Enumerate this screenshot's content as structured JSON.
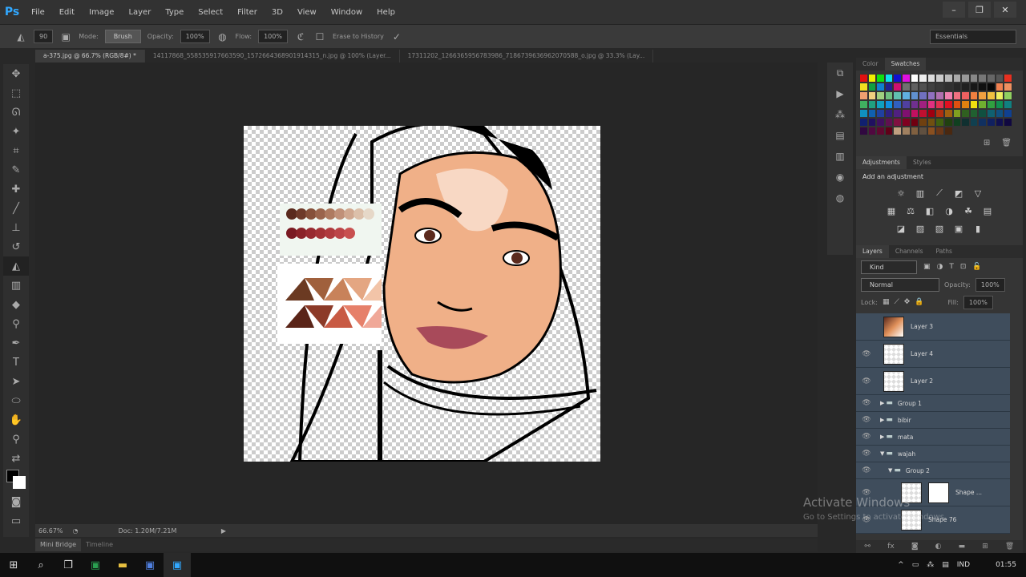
{
  "app": {
    "logo": "Ps"
  },
  "menu": [
    "File",
    "Edit",
    "Image",
    "Layer",
    "Type",
    "Select",
    "Filter",
    "3D",
    "View",
    "Window",
    "Help"
  ],
  "window_controls": {
    "minimize": "–",
    "restore": "❐",
    "close": "✕"
  },
  "options": {
    "brush_size": "90",
    "mode_label": "Mode:",
    "mode_value": "Brush",
    "opacity_label": "Opacity:",
    "opacity_value": "100%",
    "flow_label": "Flow:",
    "flow_value": "100%",
    "erase_history": "Erase to History",
    "workspace": "Essentials"
  },
  "doc_tabs": [
    {
      "label": "a-375.jpg @ 66.7% (RGB/8#) *",
      "active": true
    },
    {
      "label": "14117868_558535917663590_1572664368901914315_n.jpg @ 100% (Layer...",
      "active": false
    },
    {
      "label": "17311202_1266365956783986_7186739636962070588_o.jpg @ 33.3% (Lay...",
      "active": false
    }
  ],
  "status": {
    "zoom": "66.67%",
    "doc": "Doc: 1.20M/7.21M"
  },
  "bottom_tabs": [
    "Mini Bridge",
    "Timeline"
  ],
  "colors_panel": {
    "tabs": [
      "Color",
      "Swatches"
    ],
    "active": "Swatches"
  },
  "swatches": [
    "#e01010",
    "#f0f000",
    "#10e010",
    "#10e0f0",
    "#1010d0",
    "#e010e0",
    "#ffffff",
    "#eeeeee",
    "#dddddd",
    "#cccccc",
    "#bbbbbb",
    "#aaaaaa",
    "#999999",
    "#888888",
    "#777777",
    "#666666",
    "#555555",
    "#e83020",
    "#f0e020",
    "#10a040",
    "#1080d0",
    "#202090",
    "#d01070",
    "#707070",
    "#606060",
    "#505050",
    "#404040",
    "#383838",
    "#303030",
    "#282828",
    "#202020",
    "#181818",
    "#101010",
    "#080808",
    "#f08050",
    "#f09060",
    "#f0a070",
    "#f0d080",
    "#a0d080",
    "#70c080",
    "#60c0b0",
    "#60b0e0",
    "#6090d0",
    "#7070c0",
    "#9070c0",
    "#b070b0",
    "#f080b0",
    "#f07080",
    "#f06060",
    "#f08040",
    "#f0a040",
    "#f0c040",
    "#f0f060",
    "#90d060",
    "#40b060",
    "#20a080",
    "#10a0c0",
    "#1090e0",
    "#3060c0",
    "#5040a0",
    "#703090",
    "#a02080",
    "#e03080",
    "#e03050",
    "#e01020",
    "#e05010",
    "#e08010",
    "#f0e010",
    "#70b030",
    "#30a040",
    "#109050",
    "#108080",
    "#1090c0",
    "#1060b0",
    "#2040a0",
    "#302080",
    "#502080",
    "#801070",
    "#c01060",
    "#c01030",
    "#a00010",
    "#b03010",
    "#a06010",
    "#80a020",
    "#306020",
    "#206030",
    "#105040",
    "#106070",
    "#105080",
    "#104090",
    "#102070",
    "#201060",
    "#401060",
    "#601050",
    "#801040",
    "#800020",
    "#700010",
    "#704010",
    "#705010",
    "#406010",
    "#204010",
    "#104020",
    "#103030",
    "#104050",
    "#103060",
    "#102060",
    "#101050",
    "#100840",
    "#300840",
    "#500840",
    "#600830",
    "#600018",
    "#c0a080",
    "#a08060",
    "#806040",
    "#605040",
    "#8a5020",
    "#6a3818",
    "#4a2810"
  ],
  "adjustments": {
    "tabs": [
      "Adjustments",
      "Styles"
    ],
    "title": "Add an adjustment",
    "rows": [
      [
        "brightness-icon",
        "levels-icon",
        "curves-icon",
        "exposure-icon",
        "gradient-triangle-icon"
      ],
      [
        "vibrance-icon",
        "hue-saturation-icon",
        "color-balance-icon",
        "black-white-icon",
        "photo-filter-icon",
        "channel-mixer-icon"
      ],
      [
        "invert-icon",
        "posterize-icon",
        "threshold-icon",
        "selective-color-icon",
        "gradient-map-icon"
      ]
    ],
    "glyphs": [
      [
        "☼",
        "▥",
        "⟋",
        "◩",
        "▽"
      ],
      [
        "▦",
        "⚖",
        "◧",
        "◑",
        "☘",
        "▤"
      ],
      [
        "◪",
        "▨",
        "▧",
        "▣",
        "▮"
      ]
    ]
  },
  "layers_panel": {
    "tabs": [
      "Layers",
      "Channels",
      "Paths"
    ],
    "filter": "Kind",
    "blend": "Normal",
    "opacity_label": "Opacity:",
    "opacity": "100%",
    "lock_label": "Lock:",
    "fill_label": "Fill:",
    "fill": "100%",
    "layers": [
      {
        "name": "Layer 3",
        "type": "photo",
        "visible": false
      },
      {
        "name": "Layer 4",
        "type": "layer",
        "visible": true
      },
      {
        "name": "Layer 2",
        "type": "layer",
        "visible": true
      },
      {
        "name": "Group 1",
        "type": "group",
        "expanded": false,
        "visible": true
      },
      {
        "name": "bibir",
        "type": "group",
        "expanded": false,
        "visible": true
      },
      {
        "name": "mata",
        "type": "group",
        "expanded": false,
        "visible": true
      },
      {
        "name": "wajah",
        "type": "group",
        "expanded": true,
        "visible": true
      },
      {
        "name": "Group 2",
        "type": "group",
        "expanded": true,
        "visible": true,
        "indent": true
      },
      {
        "name": "Shape ...",
        "type": "shape-mask",
        "visible": true
      },
      {
        "name": "Shape 76",
        "type": "shape",
        "visible": true
      }
    ]
  },
  "palette": {
    "row1": [
      "#5a2a1e",
      "#6e3a2a",
      "#86503a",
      "#9a644c",
      "#ae7a60",
      "#c09078",
      "#d0a890",
      "#dcc0aa",
      "#e6d8c8"
    ],
    "row2": [
      "#7a1a22",
      "#8a2228",
      "#982a30",
      "#a43236",
      "#b03a3e",
      "#bc4448",
      "#c85050"
    ],
    "tri1": [
      "#6b3a22",
      "#a0603c",
      "#c8825a",
      "#e4a682",
      "#f2c4a8",
      "#f8dccc"
    ],
    "tri2": [
      "#5a2418",
      "#8c3a28",
      "#c85a44",
      "#e6806a",
      "#f0a898",
      "#f6c8bc"
    ]
  },
  "watermark": {
    "line1": "Activate Windows",
    "line2": "Go to Settings to activate Windows."
  },
  "taskbar": {
    "lang": "IND",
    "time": "01:55"
  }
}
